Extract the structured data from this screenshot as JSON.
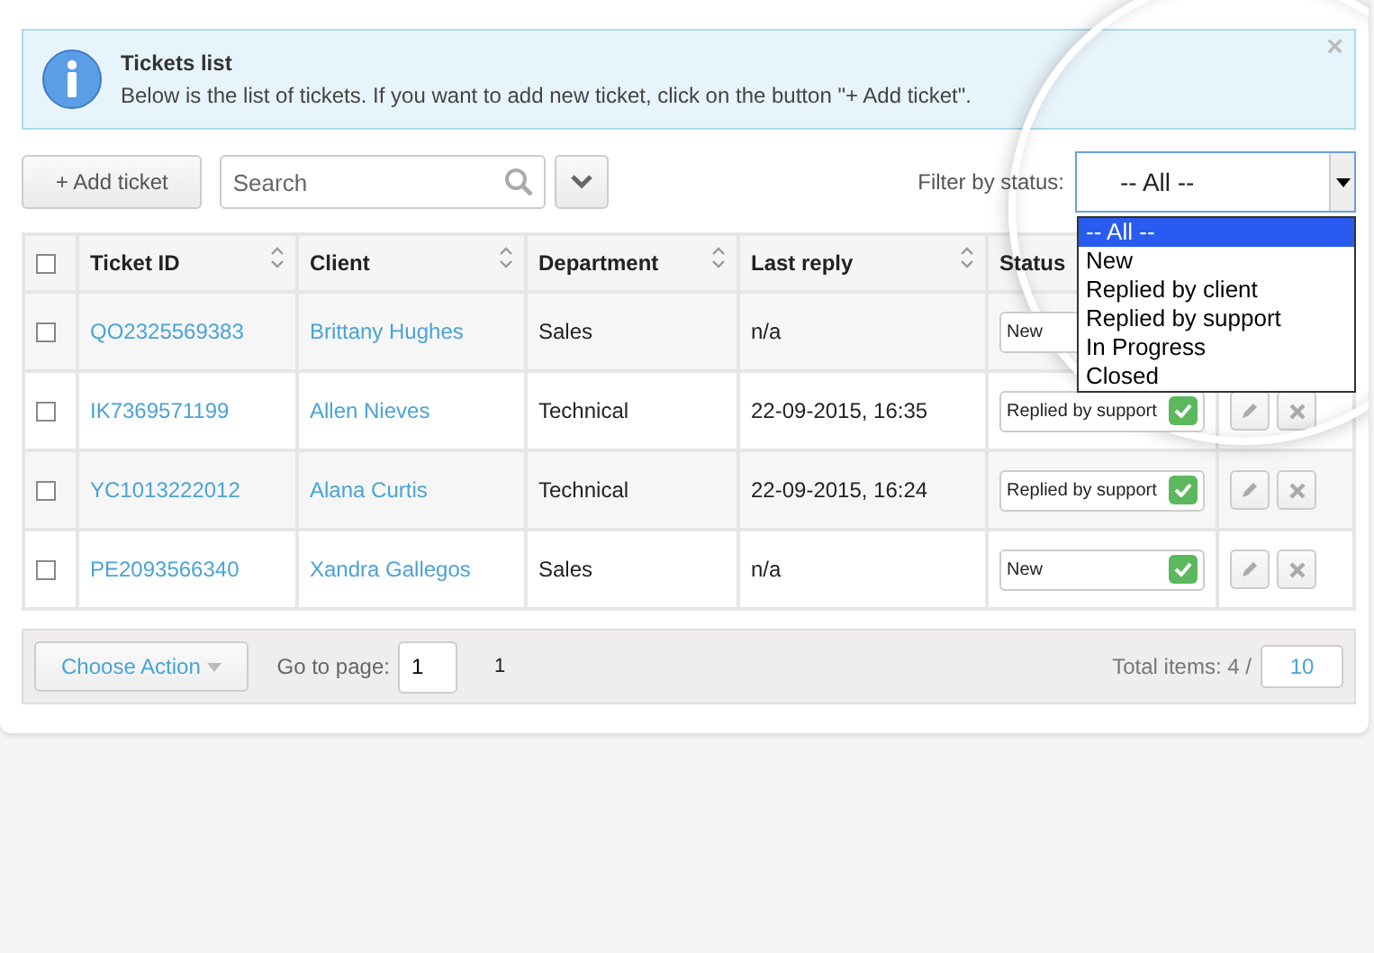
{
  "alert": {
    "title": "Tickets list",
    "message": "Below is the list of tickets. If you want to add new ticket, click on the button \"+ Add ticket\".",
    "close": "×"
  },
  "toolbar": {
    "add_button": "+ Add ticket",
    "search": {
      "placeholder": "Search"
    },
    "filter_label": "Filter by status:",
    "filter_value": "-- All --"
  },
  "status_options": [
    {
      "label": "-- All --",
      "selected": true
    },
    {
      "label": "New",
      "selected": false
    },
    {
      "label": "Replied by client",
      "selected": false
    },
    {
      "label": "Replied by support",
      "selected": false
    },
    {
      "label": "In Progress",
      "selected": false
    },
    {
      "label": "Closed",
      "selected": false
    }
  ],
  "table": {
    "select_all_checked": false,
    "columns": [
      {
        "label": "Ticket ID",
        "sortable": true
      },
      {
        "label": "Client",
        "sortable": true
      },
      {
        "label": "Department",
        "sortable": true
      },
      {
        "label": "Last reply",
        "sortable": true
      },
      {
        "label": "Status",
        "sortable": false
      }
    ],
    "rows": [
      {
        "checked": false,
        "ticket_id": "QO2325569383",
        "client": "Brittany Hughes",
        "department": "Sales",
        "last_reply": "n/a",
        "status": "New"
      },
      {
        "checked": false,
        "ticket_id": "IK7369571199",
        "client": "Allen Nieves",
        "department": "Technical",
        "last_reply": "22-09-2015, 16:35",
        "status": "Replied by support"
      },
      {
        "checked": false,
        "ticket_id": "YC1013222012",
        "client": "Alana Curtis",
        "department": "Technical",
        "last_reply": "22-09-2015, 16:24",
        "status": "Replied by support"
      },
      {
        "checked": false,
        "ticket_id": "PE2093566340",
        "client": "Xandra Gallegos",
        "department": "Sales",
        "last_reply": "n/a",
        "status": "New"
      }
    ]
  },
  "footer": {
    "action_button": "Choose Action",
    "goto_label": "Go to page:",
    "goto_value": "1",
    "pages": [
      "1"
    ],
    "total_label": "Total items: 4 /",
    "per_page": "10"
  }
}
